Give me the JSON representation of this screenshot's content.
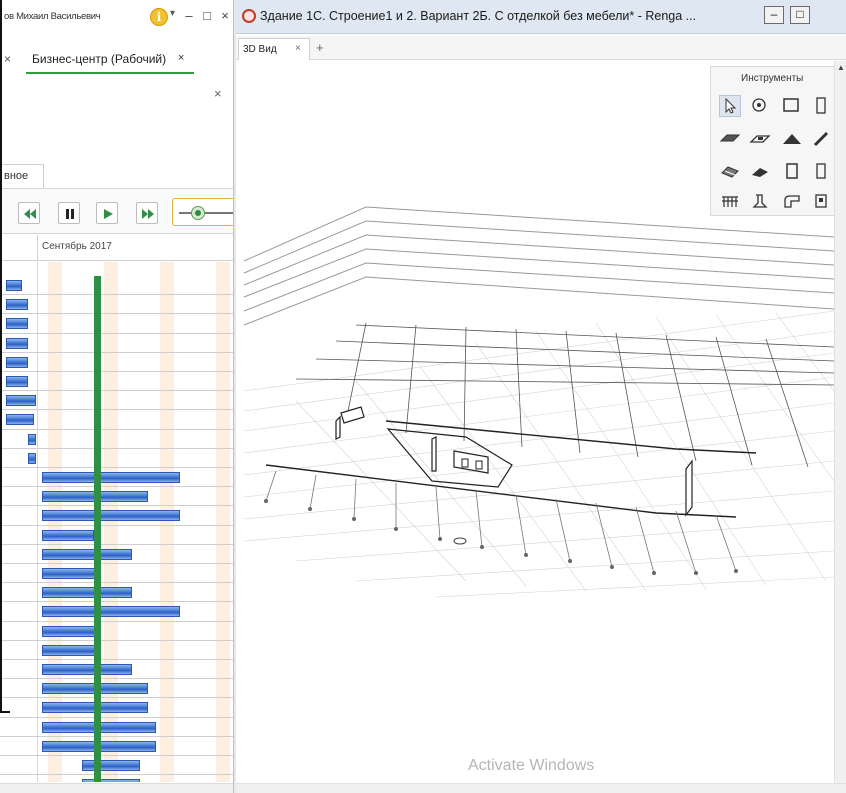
{
  "left_window": {
    "title_user": "ов Михаил Васильевич",
    "doc_tab_label": "Бизнес-центр (Рабочий)",
    "doc_tab_close": "×",
    "prev_tab_close": "×",
    "panel_close": "×",
    "title_buttons": {
      "minimize": "–",
      "restore": "□",
      "close": "×"
    },
    "info_dropdown": "▾",
    "main_tab_label": "вное",
    "gantt_month": "Сентябрь 2017",
    "playback": [
      "rewind",
      "pause",
      "play",
      "fast-forward"
    ],
    "info_icon_glyph": "i"
  },
  "right_window": {
    "title": "Здание 1С. Строение1 и 2. Вариант 2Б. С отделкой без мебели* - Renga ...",
    "buttons": {
      "minimize": "–",
      "maximize": "□"
    },
    "view_tab": "3D Вид",
    "view_tab_close": "×",
    "new_tab": "+",
    "tools_header": "Инструменты",
    "watermark": "Activate Windows",
    "scroll_up": "▲"
  },
  "colors": {
    "accent_green": "#2e9e3e",
    "today_line": "#2f8f47",
    "task_bar": "#3f78d6",
    "title_bar_right": "#dfe8f2"
  }
}
